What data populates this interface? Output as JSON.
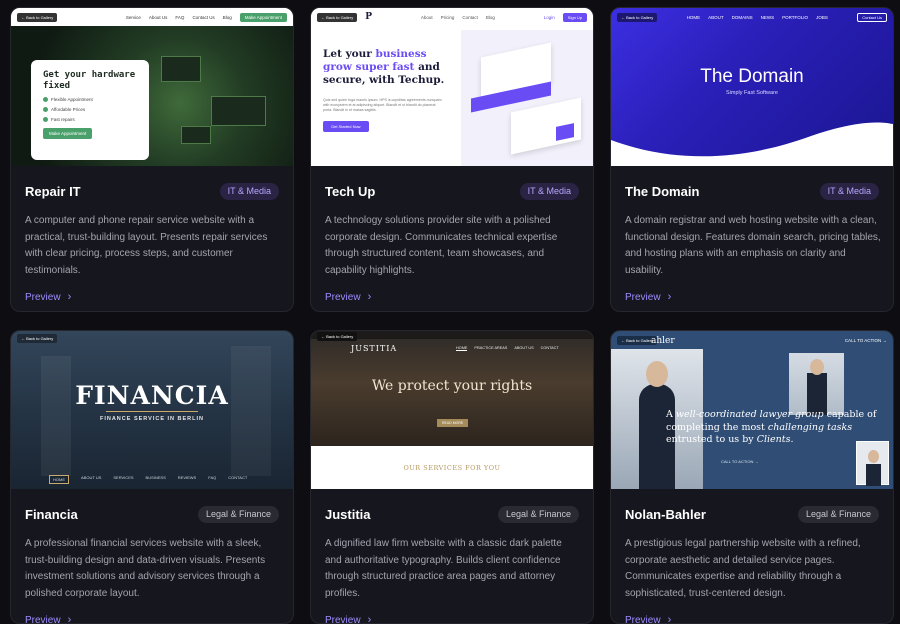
{
  "preview_label": "Preview",
  "cards": [
    {
      "title": "Repair IT",
      "badge": "IT & Media",
      "description": "A computer and phone repair service website with a practical, trust-building layout. Presents repair services with clear pricing, process steps, and customer testimonials.",
      "mock": {
        "back": "← Back to Gallery",
        "nav": [
          "Service",
          "About Us",
          "FAQ",
          "Contact Us",
          "Blog"
        ],
        "cta": "Make Appointment",
        "hero": "Get your hardware fixed",
        "bullets": [
          "Flexible Appointment",
          "Affordable Prices",
          "Fast repairs"
        ],
        "button": "Make Appointment"
      }
    },
    {
      "title": "Tech Up",
      "badge": "IT & Media",
      "description": "A technology solutions provider site with a polished corporate design. Communicates technical expertise through structured content, team showcases, and capability highlights.",
      "mock": {
        "back": "← Back to Gallery",
        "logo": "P",
        "nav": [
          "About",
          "Pricing",
          "Contact",
          "Blog"
        ],
        "login": "Login",
        "signup": "Sign Up",
        "hero_a": "Let your ",
        "hero_b": "business grow super fast",
        "hero_c": " and secure, with Techup.",
        "sub": "Quis sed quam fuga mauris ipsum. HPS is cupiditas agreements nunquam with ecosystem et at adipiscing aliquet. Blandit et ut blandit do placerat porta. Blandit in et massa sagittis.",
        "button": "Get Started Now"
      }
    },
    {
      "title": "The Domain",
      "badge": "IT & Media",
      "description": "A domain registrar and web hosting website with a clean, functional design. Features domain search, pricing tables, and hosting plans with an emphasis on clarity and usability.",
      "mock": {
        "back": "← Back to Gallery",
        "nav": [
          "HOME",
          "ABOUT",
          "DOMAINS",
          "NEWS",
          "PORTFOLIO",
          "JOBS"
        ],
        "contact": "Contact Us",
        "hero": "The Domain",
        "sub": "Simply Fast Software"
      }
    },
    {
      "title": "Financia",
      "badge": "Legal & Finance",
      "description": "A professional financial services website with a sleek, trust-building design and data-driven visuals. Presents investment solutions and advisory services through a polished corporate layout.",
      "mock": {
        "back": "← Back to Gallery",
        "hero": "FINANCIA",
        "sub": "FINANCE SERVICE IN BERLIN",
        "nav": [
          "HOME",
          "ABOUT US",
          "SERVICES",
          "BUSINESS",
          "REVIEWS",
          "FAQ",
          "CONTACT"
        ]
      }
    },
    {
      "title": "Justitia",
      "badge": "Legal & Finance",
      "description": "A dignified law firm website with a classic dark palette and authoritative typography. Builds client confidence through structured practice area pages and attorney profiles.",
      "mock": {
        "back": "← Back to Gallery",
        "logo": "JUSTITIA",
        "nav": [
          "HOME",
          "PRACTICE AREAS",
          "ABOUT US",
          "CONTACT"
        ],
        "hero": "We protect your rights",
        "button": "READ MORE",
        "services": "OUR SERVICES FOR YOU"
      }
    },
    {
      "title": "Nolan-Bahler",
      "badge": "Legal & Finance",
      "description": "A prestigious legal partnership website with a refined, corporate aesthetic and detailed service pages. Communicates expertise and reliability through a sophisticated, trust-centered design.",
      "mock": {
        "back": "← Back to Gallery",
        "logo": "ahler",
        "cta": "CALL TO ACTION →",
        "hero_1": "A ",
        "hero_2": "well-coordinated lawyer group",
        "hero_3": " capable of completing the most ",
        "hero_4": "challenging tasks",
        "hero_5": " entrusted to us by ",
        "hero_6": "Clients",
        "hero_7": ".",
        "call": "CALL TO ACTION →"
      }
    }
  ],
  "colors": {
    "background": "#0d0d12",
    "card": "#16161e",
    "accent": "#9b8cff",
    "it_badge": "#2a2344",
    "legal_badge": "#2a2a33"
  },
  "icons": {
    "preview": "chevron-right-icon"
  }
}
